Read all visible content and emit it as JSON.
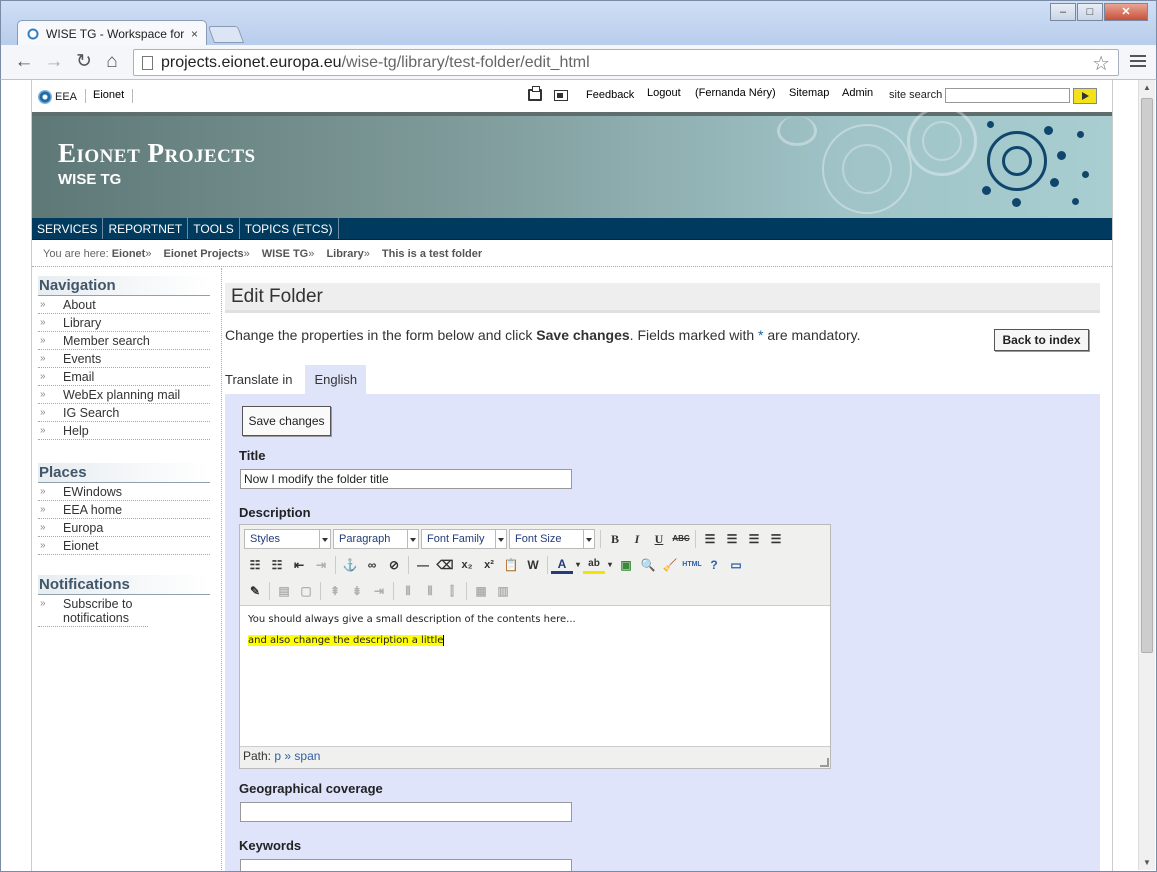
{
  "browser": {
    "tab_title": "WISE TG - Workspace for W",
    "tab_close": "×",
    "url_host": "projects.eionet.europa.eu",
    "url_path": "/wise-tg/library/test-folder/edit_html",
    "win_minimize": "–",
    "win_maximize": "□",
    "win_close": "✕",
    "back": "←",
    "forward": "→",
    "reload": "↻",
    "home": "⌂",
    "bookmark_star": "☆"
  },
  "topbar": {
    "eea": "EEA",
    "eionet": "Eionet",
    "links": {
      "feedback": "Feedback",
      "logout": "Logout",
      "user": "(Fernanda Néry)",
      "sitemap": "Sitemap",
      "admin": "Admin"
    },
    "search_label": "site search"
  },
  "banner": {
    "title": "Eionet Projects",
    "subtitle": "WISE TG"
  },
  "mainnav": [
    "SERVICES",
    "REPORTNET",
    "TOOLS",
    "TOPICS (ETCS)"
  ],
  "breadcrumb": {
    "prefix": "You are here:",
    "items": [
      "Eionet",
      "Eionet Projects",
      "WISE TG",
      "Library",
      "This is a test folder"
    ],
    "separator": "»"
  },
  "sidebar": {
    "navigation": {
      "title": "Navigation",
      "items": [
        "About",
        "Library",
        "Member search",
        "Events",
        "Email",
        "WebEx planning mail",
        "IG Search",
        "Help"
      ]
    },
    "places": {
      "title": "Places",
      "items": [
        "EWindows",
        "EEA home",
        "Europa",
        "Eionet"
      ]
    },
    "notifications": {
      "title": "Notifications",
      "items": [
        "Subscribe to notifications"
      ]
    }
  },
  "content": {
    "heading": "Edit Folder",
    "intro_pre": "Change the properties in the form below and click ",
    "intro_bold": "Save changes",
    "intro_mid": ". Fields marked with ",
    "intro_star": "*",
    "intro_post": " are mandatory.",
    "back_button": "Back to index",
    "translate_label": "Translate in",
    "translate_lang": "English",
    "save_button": "Save changes",
    "title_label": "Title",
    "title_value": "Now I modify the folder title",
    "description_label": "Description",
    "geo_label": "Geographical coverage",
    "geo_value": "",
    "keywords_label": "Keywords"
  },
  "editor": {
    "styles": "Styles",
    "format": "Paragraph",
    "font_family": "Font Family",
    "font_size": "Font Size",
    "paragraph1": "You should always give a small description of the contents here...",
    "paragraph2": "and also change the description a little",
    "path_label": "Path:",
    "path_value": "p » span",
    "buttons_row1": [
      "B",
      "I",
      "U",
      "ABC"
    ],
    "html_label": "HTML"
  }
}
